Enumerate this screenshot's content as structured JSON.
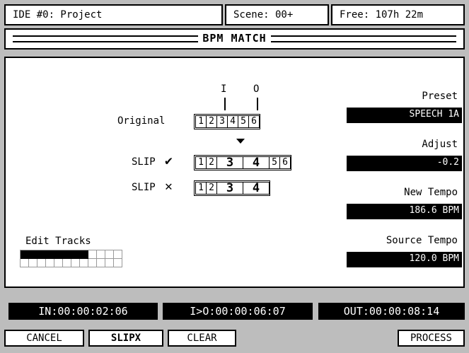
{
  "header": {
    "project": "IDE #0: Project",
    "scene": "Scene: 00+",
    "free": "Free: 107h 22m"
  },
  "title": "BPM MATCH",
  "diagram": {
    "in_marker": "I",
    "out_marker": "O",
    "original_label": "Original",
    "original_segments": [
      "1",
      "2",
      "3",
      "4",
      "5",
      "6"
    ],
    "slip_check_label": "SLIP",
    "slip_check_symbol": "✔",
    "slip_check_segments": [
      "1",
      "2",
      "3",
      "4",
      "5",
      "6"
    ],
    "slip_x_label": "SLIP",
    "slip_x_symbol": "✕",
    "slip_x_segments": [
      "1",
      "2",
      "3",
      "4"
    ]
  },
  "edit_tracks": {
    "label": "Edit Tracks",
    "enabled": [
      1,
      1,
      1,
      1,
      1,
      1,
      1,
      1,
      0,
      0,
      0,
      0
    ]
  },
  "params": {
    "preset_label": "Preset",
    "preset_value": "SPEECH 1A",
    "adjust_label": "Adjust",
    "adjust_value": "-0.2",
    "new_tempo_label": "New Tempo",
    "new_tempo_value": "186.6 BPM",
    "source_tempo_label": "Source Tempo",
    "source_tempo_value": "120.0 BPM"
  },
  "timecodes": {
    "in": "IN:00:00:02:06",
    "io": "I>O:00:00:06:07",
    "out": "OUT:00:00:08:14"
  },
  "buttons": {
    "cancel": "CANCEL",
    "slipx": "SLIPX",
    "clear": "CLEAR",
    "process": "PROCESS"
  }
}
